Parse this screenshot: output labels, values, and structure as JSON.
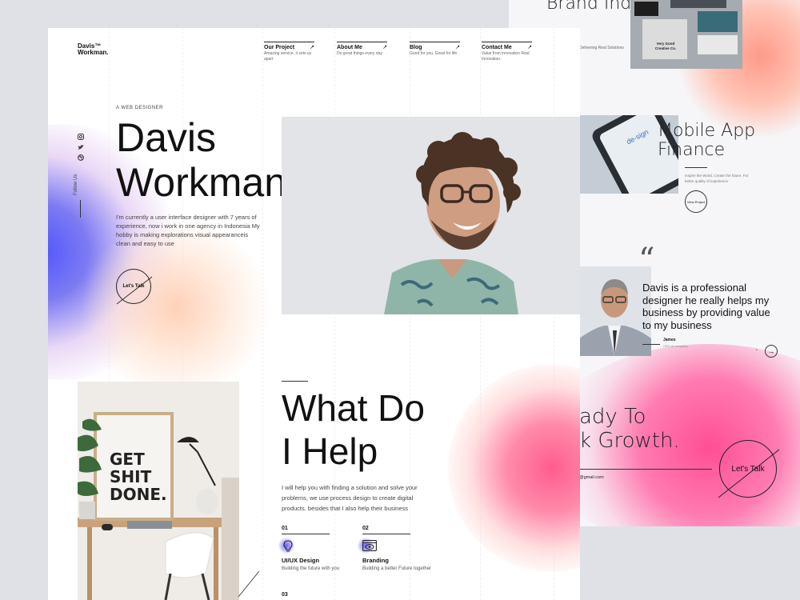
{
  "colors": {
    "accent_blue": "#5055ff",
    "accent_pink": "#ff4f93",
    "ink": "#111111"
  },
  "back_page": {
    "brand": {
      "title": "Brand Indentity -",
      "desc": "Delivering Real Solutions",
      "card_text": "Very Good Creative Co."
    },
    "mobile": {
      "title_line1": "Mobile App",
      "title_line2": "Finance",
      "desc": "Inspire the World, Create the future, For better quality of experience",
      "button": "View Project",
      "screen_text": "de-sign"
    },
    "testimonial": {
      "quote_mark": "“",
      "text": "Davis is a professional designer he really helps my business by providing value to my business",
      "name": "James",
      "role": "CEO at company",
      "next_icon": "arrow-right-icon"
    },
    "cta": {
      "line1": "ady To",
      "line2": "k Growth.",
      "email": "@gmail.com",
      "button": "Let's Talk"
    }
  },
  "front_page": {
    "logo_line1": "Davis™",
    "logo_line2": "Workman.",
    "nav": [
      {
        "title": "Our Project",
        "desc": "Amazing service, it sets us apart",
        "arrow": "↗"
      },
      {
        "title": "About Me",
        "desc": "Do great things every day",
        "arrow": "↗"
      },
      {
        "title": "Blog",
        "desc": "Good for you. Great for life.",
        "arrow": "↗"
      },
      {
        "title": "Contact Me",
        "desc": "Value from innovation Real Innovation.",
        "arrow": "↗"
      }
    ],
    "hero": {
      "eyebrow": "A WEB DESIGNER",
      "name_line1": "Davis",
      "name_line2": "Workman.",
      "desc": "I'm currently a user interface designer with 7 years of experience, now i work in one agency in Indonesia My hobby is making explorations visual appearanceis clean and easy to use",
      "button": "Let's Talk",
      "follow": "Follow Us",
      "socials": [
        "instagram-icon",
        "twitter-icon",
        "dribbble-icon"
      ]
    },
    "help": {
      "title_line1": "What Do",
      "title_line2": "I Help",
      "desc": "I will help you with finding a solution and solve your problems, we use process design to create digital products. besides that I also help their business",
      "services": [
        {
          "num": "01",
          "title": "UI/UX Design",
          "desc": "Building the future with you"
        },
        {
          "num": "02",
          "title": "Branding",
          "desc": "Building a better Future together"
        }
      ],
      "next_num": "03"
    },
    "poster_text": [
      "GET",
      "SHIT",
      "DONE."
    ]
  }
}
